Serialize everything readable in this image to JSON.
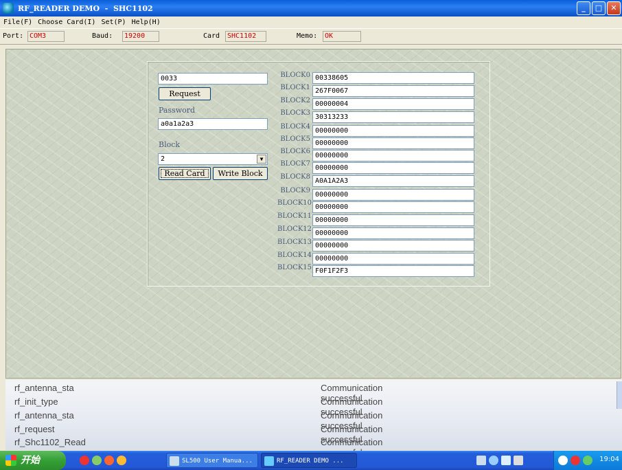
{
  "window": {
    "title": "RF_READER DEMO  -  SHC1102",
    "buttons": [
      "minimize",
      "maximize",
      "close"
    ]
  },
  "menu": [
    {
      "label": "File(F)"
    },
    {
      "label": "Choose Card(I)"
    },
    {
      "label": "Set(P)"
    },
    {
      "label": "Help(H)"
    }
  ],
  "info": {
    "port_label": "Port:",
    "port_value": "COM3",
    "baud_label": "Baud:",
    "baud_value": "19200",
    "card_label": "Card",
    "card_value": "SHC1102",
    "memo_label": "Memo:",
    "memo_value": "OK"
  },
  "form": {
    "card_id": "0033",
    "request_label": "Request",
    "password_label": "Password",
    "password_value": "a0a1a2a3",
    "block_label": "Block",
    "block_value": "2",
    "read_label": "Read Card",
    "write_label": "Write Block"
  },
  "blocks": [
    {
      "label": "BLOCK0",
      "value": "00338605"
    },
    {
      "label": "BLOCK1",
      "value": "267F0067"
    },
    {
      "label": "BLOCK2",
      "value": "00000004"
    },
    {
      "label": "BLOCK3",
      "value": "30313233"
    },
    {
      "label": "BLOCK4",
      "value": "00000000"
    },
    {
      "label": "BLOCK5",
      "value": "00000000"
    },
    {
      "label": "BLOCK6",
      "value": "00000000"
    },
    {
      "label": "BLOCK7",
      "value": "00000000"
    },
    {
      "label": "BLOCK8",
      "value": "A0A1A2A3"
    },
    {
      "label": "BLOCK9",
      "value": "00000000"
    },
    {
      "label": "BLOCK10",
      "value": "00000000"
    },
    {
      "label": "BLOCK11",
      "value": "00000000"
    },
    {
      "label": "BLOCK12",
      "value": "00000000"
    },
    {
      "label": "BLOCK13",
      "value": "00000000"
    },
    {
      "label": "BLOCK14",
      "value": "00000000"
    },
    {
      "label": "BLOCK15",
      "value": "F0F1F2F3"
    }
  ],
  "log": [
    {
      "func": "rf_antenna_sta",
      "msg": "Communication successful"
    },
    {
      "func": "rf_init_type",
      "msg": "Communication successful"
    },
    {
      "func": "rf_antenna_sta",
      "msg": "Communication successful"
    },
    {
      "func": "rf_request",
      "msg": "Communication successful"
    },
    {
      "func": "rf_Shc1102_Read",
      "msg": "Communication successful"
    }
  ],
  "taskbar": {
    "start_label": "开始",
    "tasks": [
      {
        "label": "SL500 User Manua..."
      },
      {
        "label": "RF_READER DEMO  ..."
      }
    ],
    "clock": "19:04"
  },
  "colors": {
    "title_blue": "#0a5fd8",
    "value_red": "#cc0000",
    "label_slate": "#4a5a7a",
    "texture_green": "#cdd4c3",
    "taskbar_blue": "#245edb",
    "start_green": "#34a034"
  }
}
